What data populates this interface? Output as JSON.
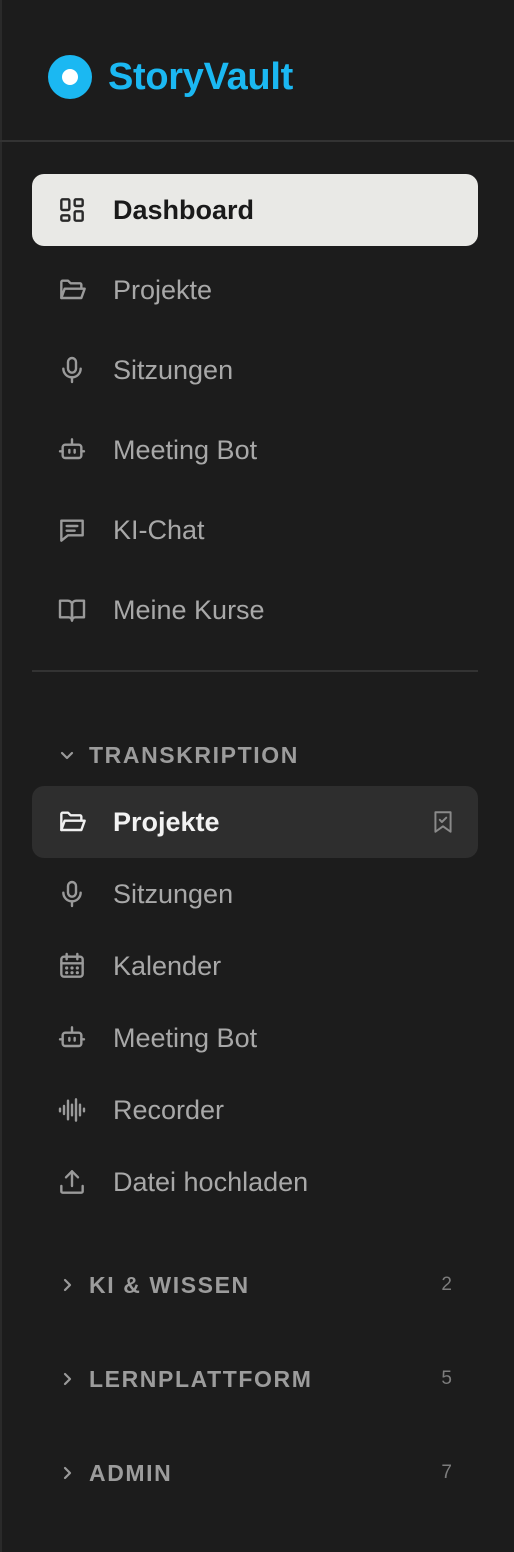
{
  "brand": {
    "name": "StoryVault",
    "accent_color": "#1bb8f2"
  },
  "main_nav": [
    {
      "label": "Dashboard",
      "icon": "dashboard-grid-icon",
      "active": true
    },
    {
      "label": "Projekte",
      "icon": "folder-open-icon"
    },
    {
      "label": "Sitzungen",
      "icon": "microphone-icon"
    },
    {
      "label": "Meeting Bot",
      "icon": "bot-icon"
    },
    {
      "label": "KI-Chat",
      "icon": "chat-icon"
    },
    {
      "label": "Meine Kurse",
      "icon": "book-open-icon"
    }
  ],
  "sections": {
    "transkription": {
      "title": "TRANSKRIPTION",
      "expanded": true,
      "items": [
        {
          "label": "Projekte",
          "icon": "folder-open-icon",
          "active": true,
          "bookmarked": true
        },
        {
          "label": "Sitzungen",
          "icon": "microphone-icon"
        },
        {
          "label": "Kalender",
          "icon": "calendar-icon"
        },
        {
          "label": "Meeting Bot",
          "icon": "bot-icon"
        },
        {
          "label": "Recorder",
          "icon": "waveform-icon"
        },
        {
          "label": "Datei hochladen",
          "icon": "upload-icon"
        }
      ]
    },
    "ki_wissen": {
      "title": "KI & WISSEN",
      "count": "2",
      "expanded": false
    },
    "lernplattform": {
      "title": "LERNPLATTFORM",
      "count": "5",
      "expanded": false
    },
    "admin": {
      "title": "ADMIN",
      "count": "7",
      "expanded": false
    }
  }
}
